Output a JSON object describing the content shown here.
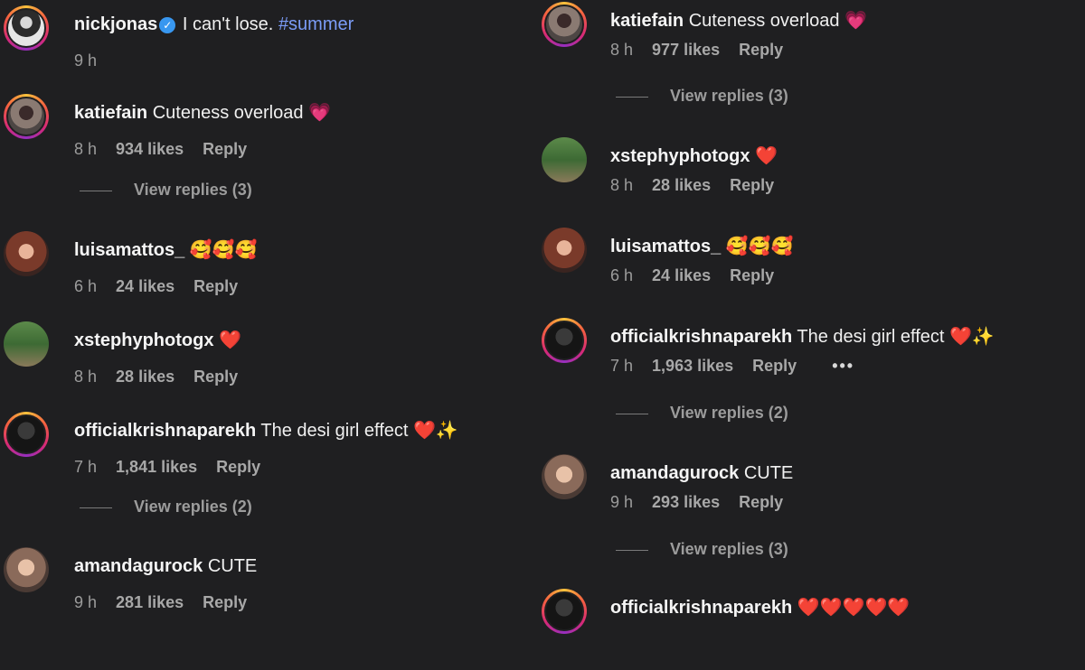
{
  "left": {
    "nickjonas": {
      "username": "nickjonas",
      "text": "I can't lose.",
      "hashtag": "#summer",
      "time": "9 h",
      "verified_glyph": "✓"
    },
    "katiefain": {
      "username": "katiefain",
      "text": "Cuteness overload",
      "emoji": "💗",
      "time": "8 h",
      "likes": "934 likes",
      "reply": "Reply",
      "view_replies": "View replies (3)"
    },
    "luisamattos": {
      "username": "luisamattos_",
      "emoji": "🥰🥰🥰",
      "time": "6 h",
      "likes": "24 likes",
      "reply": "Reply"
    },
    "xstephy": {
      "username": "xstephyphotogx",
      "emoji": "❤️",
      "time": "8 h",
      "likes": "28 likes",
      "reply": "Reply"
    },
    "krishna": {
      "username": "officialkrishnaparekh",
      "text": "The desi girl effect",
      "emoji_heart": "❤️",
      "emoji_sparkle": "✨",
      "time": "7 h",
      "likes": "1,841 likes",
      "reply": "Reply",
      "view_replies": "View replies (2)"
    },
    "amanda": {
      "username": "amandagurock",
      "text": "CUTE",
      "time": "9 h",
      "likes": "281 likes",
      "reply": "Reply"
    }
  },
  "right": {
    "katiefain": {
      "username": "katiefain",
      "text": "Cuteness overload",
      "emoji": "💗",
      "time": "8 h",
      "likes": "977 likes",
      "reply": "Reply",
      "view_replies": "View replies (3)"
    },
    "xstephy": {
      "username": "xstephyphotogx",
      "emoji": "❤️",
      "time": "8 h",
      "likes": "28 likes",
      "reply": "Reply"
    },
    "luisamattos": {
      "username": "luisamattos_",
      "emoji": "🥰🥰🥰",
      "time": "6 h",
      "likes": "24 likes",
      "reply": "Reply"
    },
    "krishna": {
      "username": "officialkrishnaparekh",
      "text": "The desi girl effect",
      "emoji_heart": "❤️",
      "emoji_sparkle": "✨",
      "time": "7 h",
      "likes": "1,963 likes",
      "reply": "Reply",
      "more": "•••",
      "view_replies": "View replies (2)"
    },
    "amanda": {
      "username": "amandagurock",
      "text": "CUTE",
      "time": "9 h",
      "likes": "293 likes",
      "reply": "Reply",
      "view_replies": "View replies (3)"
    },
    "krishna2": {
      "username": "officialkrishnaparekh",
      "emoji": "❤️❤️❤️❤️❤️"
    }
  },
  "icons": {
    "verified": "verified-badge-icon",
    "more": "more-options-icon"
  },
  "colors": {
    "background": "#1f1f21",
    "hashtag": "#7b9cf7",
    "verified": "#3897f0"
  }
}
